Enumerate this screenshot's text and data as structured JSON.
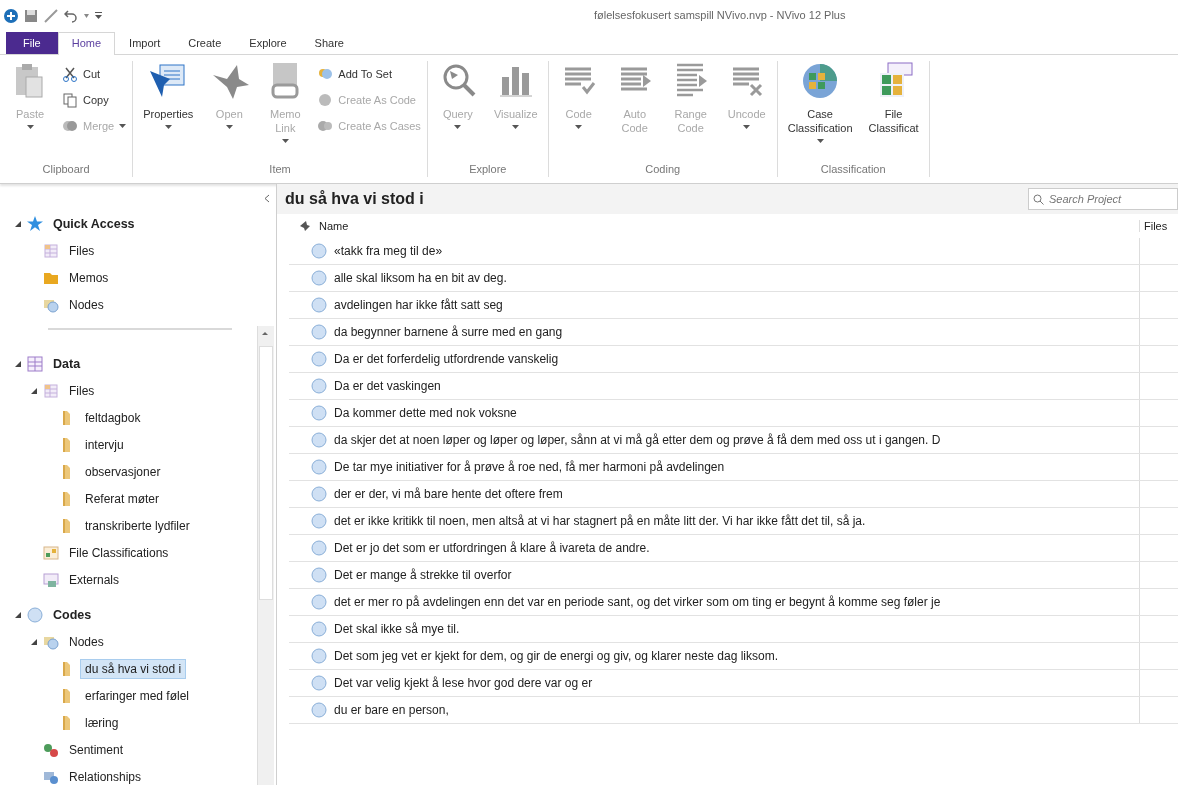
{
  "window": {
    "title": "følelsesfokusert samspill NVivo.nvp - NVivo 12 Plus"
  },
  "tabs": [
    {
      "label": "File",
      "kind": "file",
      "selected": false
    },
    {
      "label": "Home",
      "kind": "tab",
      "selected": true
    },
    {
      "label": "Import",
      "kind": "tab",
      "selected": false
    },
    {
      "label": "Create",
      "kind": "tab",
      "selected": false
    },
    {
      "label": "Explore",
      "kind": "tab",
      "selected": false
    },
    {
      "label": "Share",
      "kind": "tab",
      "selected": false
    }
  ],
  "ribbon": [
    {
      "label": "Clipboard",
      "items": [
        {
          "kind": "large",
          "lines": [
            "Paste"
          ],
          "disabled": true,
          "dropdown": true
        },
        {
          "kind": "stack",
          "items": [
            {
              "label": "Cut",
              "disabled": false,
              "dropdown": false
            },
            {
              "label": "Copy",
              "disabled": false,
              "dropdown": false
            },
            {
              "label": "Merge",
              "disabled": true,
              "dropdown": true
            }
          ]
        }
      ]
    },
    {
      "label": "Item",
      "items": [
        {
          "kind": "large",
          "lines": [
            "Properties"
          ],
          "disabled": false,
          "dropdown": true
        },
        {
          "kind": "large",
          "lines": [
            "Open"
          ],
          "disabled": true,
          "dropdown": true
        },
        {
          "kind": "large",
          "lines": [
            "Memo",
            "Link"
          ],
          "disabled": true,
          "dropdown": true
        },
        {
          "kind": "stack",
          "items": [
            {
              "label": "Add To Set",
              "disabled": false,
              "dropdown": false
            },
            {
              "label": "Create As Code",
              "disabled": true,
              "dropdown": false
            },
            {
              "label": "Create As Cases",
              "disabled": true,
              "dropdown": false
            }
          ]
        }
      ]
    },
    {
      "label": "Explore",
      "items": [
        {
          "kind": "large",
          "lines": [
            "Query"
          ],
          "disabled": true,
          "dropdown": true
        },
        {
          "kind": "large",
          "lines": [
            "Visualize"
          ],
          "disabled": true,
          "dropdown": true
        }
      ]
    },
    {
      "label": "Coding",
      "items": [
        {
          "kind": "large",
          "lines": [
            "Code"
          ],
          "disabled": true,
          "dropdown": true
        },
        {
          "kind": "large",
          "lines": [
            "Auto",
            "Code"
          ],
          "disabled": true,
          "dropdown": false
        },
        {
          "kind": "large",
          "lines": [
            "Range",
            "Code"
          ],
          "disabled": true,
          "dropdown": false
        },
        {
          "kind": "large",
          "lines": [
            "Uncode"
          ],
          "disabled": true,
          "dropdown": true
        }
      ]
    },
    {
      "label": "Classification",
      "items": [
        {
          "kind": "large",
          "lines": [
            "Case",
            "Classification"
          ],
          "disabled": false,
          "dropdown": true
        },
        {
          "kind": "large",
          "lines": [
            "File",
            "Classificat"
          ],
          "disabled": false,
          "dropdown": false
        }
      ]
    }
  ],
  "sidebar": {
    "sections": [
      {
        "label": "Quick Access",
        "kind": "star",
        "expanded": true,
        "selected": false,
        "items": [
          {
            "label": "Files",
            "kind": "files",
            "selected": false
          },
          {
            "label": "Memos",
            "kind": "memos",
            "selected": false
          },
          {
            "label": "Nodes",
            "kind": "nodes",
            "selected": false
          }
        ]
      },
      {
        "label": "Data",
        "kind": "data",
        "expanded": true,
        "selected": false,
        "items": [
          {
            "label": "Files",
            "kind": "files",
            "expanded": true,
            "selected": false,
            "children": [
              {
                "label": "feltdagbok",
                "kind": "folder",
                "selected": false
              },
              {
                "label": "intervju",
                "kind": "folder",
                "selected": false
              },
              {
                "label": "observasjoner",
                "kind": "folder",
                "selected": false
              },
              {
                "label": "Referat møter",
                "kind": "folder",
                "selected": false
              },
              {
                "label": "transkriberte lydfiler",
                "kind": "folder",
                "selected": false
              }
            ]
          },
          {
            "label": "File Classifications",
            "kind": "classifications",
            "selected": false
          },
          {
            "label": "Externals",
            "kind": "externals",
            "selected": false
          }
        ]
      },
      {
        "label": "Codes",
        "kind": "codes",
        "expanded": true,
        "selected": false,
        "items": [
          {
            "label": "Nodes",
            "kind": "nodes",
            "expanded": true,
            "selected": false,
            "children": [
              {
                "label": "du så hva vi stod i",
                "kind": "folder",
                "selected": true
              },
              {
                "label": "erfaringer med følel",
                "kind": "folder",
                "selected": false
              },
              {
                "label": "læring",
                "kind": "folder",
                "selected": false
              }
            ]
          },
          {
            "label": "Sentiment",
            "kind": "sentiment",
            "selected": false
          },
          {
            "label": "Relationships",
            "kind": "relationships",
            "selected": false
          }
        ]
      }
    ]
  },
  "main": {
    "title": "du så hva vi stod i",
    "search": {
      "placeholder": "Search Project"
    },
    "columns": [
      "Name",
      "Files"
    ],
    "rows": [
      "«takk fra meg til de»",
      "alle skal liksom ha en bit av deg.",
      "avdelingen har ikke fått satt seg",
      "da begynner barnene å surre med en gang",
      "Da er det forferdelig utfordrende vanskelig",
      "Da er det vaskingen",
      "Da kommer dette med nok voksne",
      "da skjer det at noen løper og løper og løper, sånn at vi må gå etter dem og prøve å få dem med oss ut i gangen. D",
      "De tar mye initiativer for å prøve å roe ned, få mer harmoni på avdelingen",
      "der er der, vi må bare hente det oftere frem",
      "det er ikke kritikk til noen, men altså at vi har stagnert på en måte litt der. Vi har ikke fått det til, så ja.",
      "Det er jo det som er utfordringen å klare å ivareta de andre.",
      "Det er mange å strekke til overfor",
      "det er mer ro på avdelingen enn det var en periode sant, og det virker som om ting er begynt å komme seg føler je",
      "Det skal ikke så mye til.",
      "Det som jeg vet er kjekt for dem, og gir de energi og giv, og klarer neste dag liksom.",
      "Det var velig kjekt å lese hvor god dere var og er",
      "du er bare en person,"
    ]
  }
}
